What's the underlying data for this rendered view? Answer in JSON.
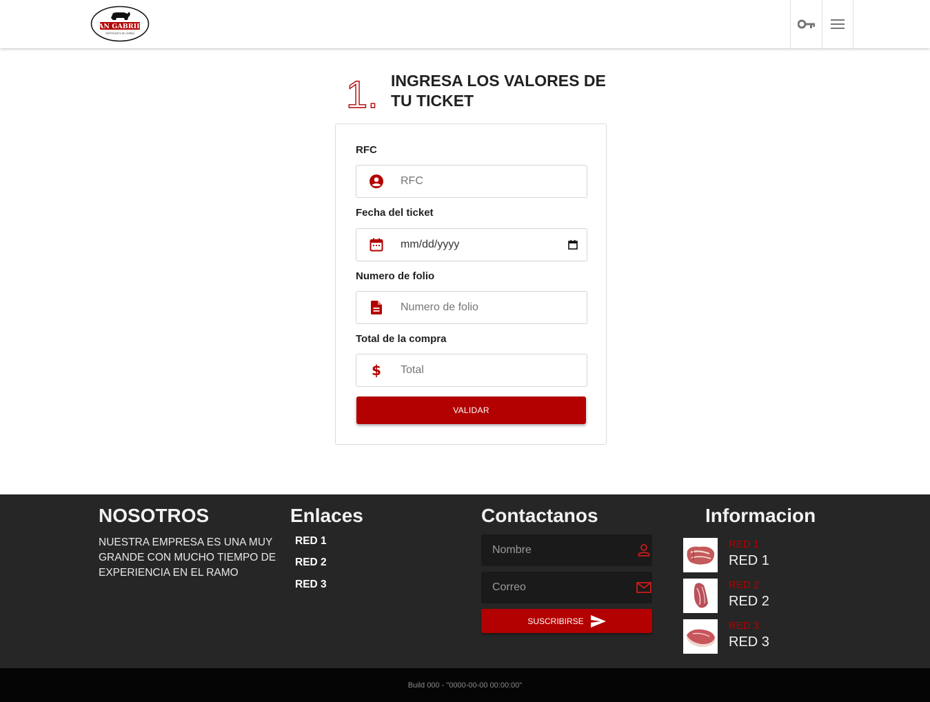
{
  "header": {
    "logo_text": "SAN GABRIEL",
    "logo_subtext": "CRATTACEROS DE CARNES",
    "key_icon": "key-icon",
    "menu_icon": "hamburger-menu-icon"
  },
  "step": {
    "number": "1.",
    "title": "INGRESA LOS VALORES DE TU TICKET"
  },
  "form": {
    "rfc": {
      "label": "RFC",
      "placeholder": "RFC",
      "icon": "account-circle-icon"
    },
    "fecha": {
      "label": "Fecha del ticket",
      "value": "mm/dd/yyyy",
      "icon": "calendar-icon"
    },
    "folio": {
      "label": "Numero de folio",
      "placeholder": "Numero de folio",
      "icon": "document-icon"
    },
    "total": {
      "label": "Total de la compra",
      "placeholder": "Total",
      "icon": "dollar-icon"
    },
    "submit_label": "VALIDAR"
  },
  "footer": {
    "about": {
      "title": "NOSOTROS",
      "text": "NUESTRA EMPRESA ES UNA MUY GRANDE CON MUCHO TIEMPO DE EXPERIENCIA EN EL RAMO"
    },
    "links": {
      "title": "Enlaces",
      "items": [
        "RED 1",
        "RED 2",
        "RED 3"
      ]
    },
    "contact": {
      "title": "Contactanos",
      "name_placeholder": "Nombre",
      "email_placeholder": "Correo",
      "subscribe_label": "SUSCRIBIRSE"
    },
    "info": {
      "title": "Informacion",
      "items": [
        {
          "sub": "RED 1",
          "main": "RED 1"
        },
        {
          "sub": "RED 2",
          "main": "RED 2"
        },
        {
          "sub": "RED 3",
          "main": "RED 3"
        }
      ]
    }
  },
  "build": "Build 000 - \"0000-00-00 00:00:00\"",
  "colors": {
    "accent": "#b30000",
    "footer_bg": "#262626",
    "bottom_bar": "#050505"
  }
}
